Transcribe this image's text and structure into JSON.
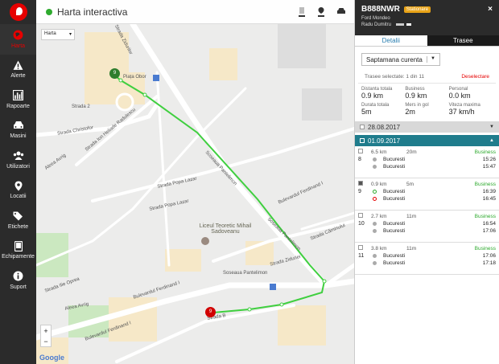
{
  "sidebar": {
    "items": [
      {
        "label": "Harta",
        "icon": "globe-icon"
      },
      {
        "label": "Alerte",
        "icon": "warning-icon"
      },
      {
        "label": "Rapoarte",
        "icon": "chart-icon"
      },
      {
        "label": "Masini",
        "icon": "car-icon"
      },
      {
        "label": "Utilizatori",
        "icon": "users-icon"
      },
      {
        "label": "Locatii",
        "icon": "pin-icon"
      },
      {
        "label": "Etichete",
        "icon": "tags-icon"
      },
      {
        "label": "Echipamente",
        "icon": "device-icon"
      },
      {
        "label": "Suport",
        "icon": "info-icon"
      }
    ]
  },
  "map": {
    "title": "Harta interactiva",
    "select_value": "Harta",
    "zoom_in": "+",
    "zoom_out": "−",
    "google": "Google",
    "labels": {
      "strada_zidurilor": "Strada Zidurilor",
      "piata_obor": "Piața Obor",
      "aleea_avrig_top": "Aleea Avrig",
      "strada_christofor": "Strada Christofor",
      "strada_radulescu": "Strada Ion Heliade Radulescu",
      "strada_popa_lazar": "Strada Popa Lazar",
      "strada_popa_lazar2": "Strada Popa Lazar",
      "soseaua_pantelimon": "Soseaua Pantelimon",
      "soseaua_pantelimon2": "Soseaua Pantelimon",
      "bulevardul_ferdinand": "Bulevardul Ferdinand I",
      "bulevardul_ferdinand2": "Bulevardul Ferdinand I",
      "liceul": "Liceul Teoretic Mihail Sadoveanu",
      "strada_zizurului": "Strada Ziduriei",
      "strada_camunului": "Strada Căminului",
      "strada_ilie": "Strada Ilie Oprea",
      "aleea_avrig_bottom": "Aleea Avrig",
      "strada_bucur": "Strada Bucur",
      "strada_b": "Strada B",
      "soseaua_pantelimon_stop": "Soseaua Pantelimon",
      "unirii": "Unirii",
      "strada_2": "Strada 2",
      "strada_vlaicu": "Strada Vlaicu"
    },
    "markers": {
      "start": "9",
      "end": "9"
    }
  },
  "panel": {
    "plate": "B888NWR",
    "status": "Stationare",
    "vehicle": "Ford Mondeo",
    "driver": "Radu Dumitru",
    "close": "×",
    "tabs": [
      "Detalii",
      "Trasee"
    ],
    "period": "Saptamana curenta",
    "selected": "Trasee selectate: 1 din 11",
    "deselect": "Deselectare",
    "stats": [
      {
        "label": "Distanta totala",
        "value": "0.9 km"
      },
      {
        "label": "Business",
        "value": "0.9 km"
      },
      {
        "label": "Personal",
        "value": "0.0 km"
      },
      {
        "label": "Durata totala",
        "value": "5m"
      },
      {
        "label": "Mers in gol",
        "value": "2m"
      },
      {
        "label": "Viteza maxima",
        "value": "37 km/h"
      }
    ],
    "dates": [
      {
        "date": "28.08.2017",
        "arrow": "▼"
      },
      {
        "date": "01.09.2017",
        "arrow": "▲"
      }
    ],
    "trips": [
      {
        "num": "8",
        "dist": "6.5 km",
        "dur": "20m",
        "class": "Business",
        "from": "Bucuresti",
        "from_time": "15:26",
        "to": "Bucuresti",
        "to_time": "15:47",
        "checked": false
      },
      {
        "num": "9",
        "dist": "0.9 km",
        "dur": "5m",
        "class": "Business",
        "from": "Bucuresti",
        "from_time": "16:39",
        "to": "Bucuresti",
        "to_time": "16:45",
        "checked": true
      },
      {
        "num": "10",
        "dist": "2.7 km",
        "dur": "11m",
        "class": "Business",
        "from": "Bucuresti",
        "from_time": "16:54",
        "to": "Bucuresti",
        "to_time": "17:06",
        "checked": false
      },
      {
        "num": "11",
        "dist": "3.8 km",
        "dur": "11m",
        "class": "Business",
        "from": "Bucuresti",
        "from_time": "17:06",
        "to": "Bucuresti",
        "to_time": "17:18",
        "checked": false
      }
    ]
  },
  "colors": {
    "accent": "#e60000",
    "route": "#3fcf3f",
    "teal": "#1f7c8c",
    "badge": "#e8a317"
  }
}
